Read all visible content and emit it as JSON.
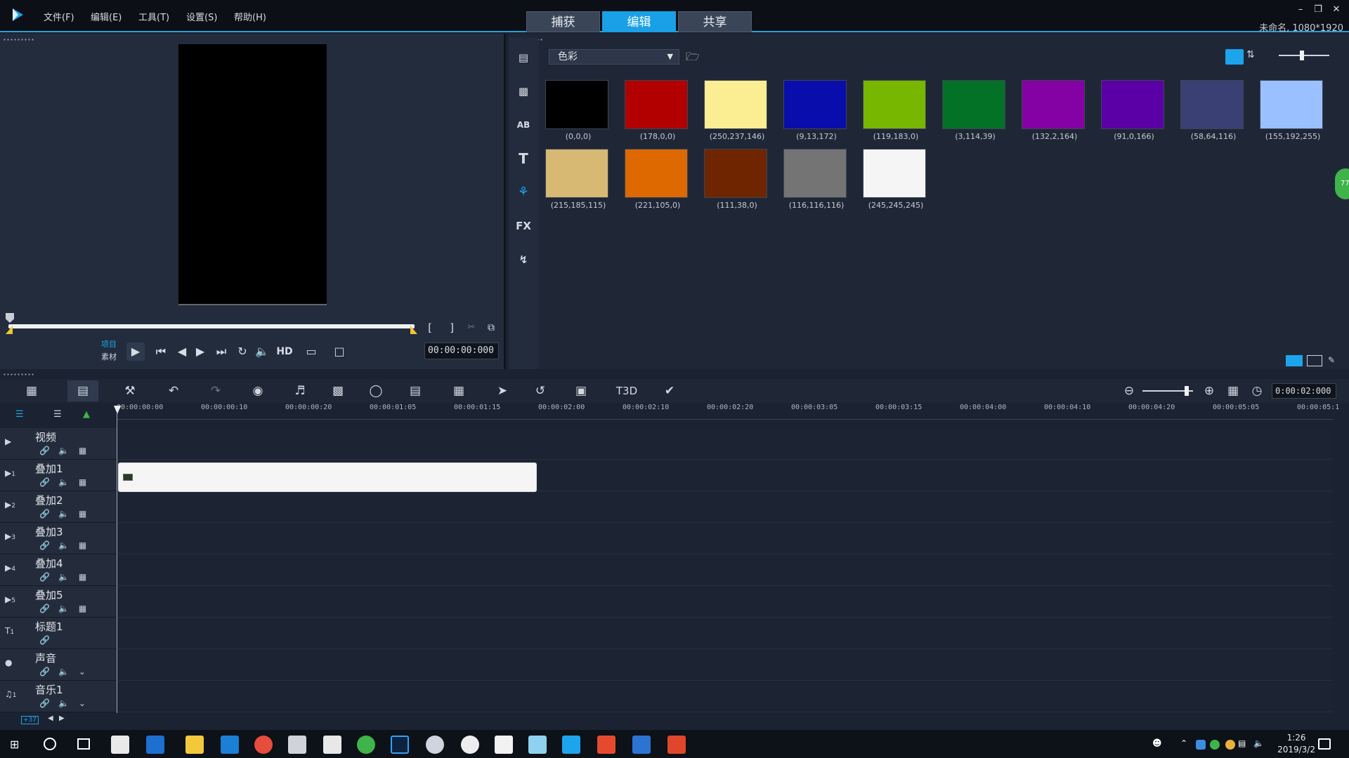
{
  "titlebar": {
    "menus": [
      "文件(F)",
      "编辑(E)",
      "工具(T)",
      "设置(S)",
      "帮助(H)"
    ],
    "mode_tabs": [
      {
        "label": "捕获",
        "active": false
      },
      {
        "label": "编辑",
        "active": true
      },
      {
        "label": "共享",
        "active": false
      }
    ],
    "project_info": "未命名, 1080*1920",
    "window_controls": [
      "minimize-icon",
      "restore-icon",
      "close-icon"
    ]
  },
  "player": {
    "mode_project": "项目",
    "mode_clip": "素材",
    "timecode": "00:00:00:000",
    "hd_label": "HD"
  },
  "library": {
    "dropdown": "色彩",
    "swatches": [
      {
        "label": "(0,0,0)",
        "color": "#000000"
      },
      {
        "label": "(178,0,0)",
        "color": "#b20000"
      },
      {
        "label": "(250,237,146)",
        "color": "#faed92"
      },
      {
        "label": "(9,13,172)",
        "color": "#090dac"
      },
      {
        "label": "(119,183,0)",
        "color": "#77b700"
      },
      {
        "label": "(3,114,39)",
        "color": "#037227"
      },
      {
        "label": "(132,2,164)",
        "color": "#8402a4"
      },
      {
        "label": "(91,0,166)",
        "color": "#5b00a6"
      },
      {
        "label": "(58,64,116)",
        "color": "#3a4074"
      },
      {
        "label": "(155,192,255)",
        "color": "#9bc0ff"
      },
      {
        "label": "(215,185,115)",
        "color": "#d7b973"
      },
      {
        "label": "(221,105,0)",
        "color": "#dd6900"
      },
      {
        "label": "(111,38,0)",
        "color": "#6f2600"
      },
      {
        "label": "(116,116,116)",
        "color": "#747474"
      },
      {
        "label": "(245,245,245)",
        "color": "#f5f5f5"
      }
    ],
    "side_icons": [
      "media-icon",
      "instant-project-icon",
      "transition-icon",
      "title-icon",
      "color-icon",
      "fx-icon",
      "path-icon"
    ],
    "fx_label": "FX",
    "title_glyph": "T",
    "transition_glyph": "AB"
  },
  "timeline": {
    "timecode": "0:00:02:000",
    "ruler": [
      "00:00:00:00",
      "00:00:00:10",
      "00:00:00:20",
      "00:00:01:05",
      "00:00:01:15",
      "00:00:02:00",
      "00:00:02:10",
      "00:00:02:20",
      "00:00:03:05",
      "00:00:03:15",
      "00:00:04:00",
      "00:00:04:10",
      "00:00:04:20",
      "00:00:05:05",
      "00:00:05:1"
    ],
    "tracks": [
      {
        "name": "视频",
        "icon": "video-track-icon",
        "badge": ""
      },
      {
        "name": "叠加1",
        "icon": "overlay-track-icon",
        "badge": "1"
      },
      {
        "name": "叠加2",
        "icon": "overlay-track-icon",
        "badge": "2"
      },
      {
        "name": "叠加3",
        "icon": "overlay-track-icon",
        "badge": "3"
      },
      {
        "name": "叠加4",
        "icon": "overlay-track-icon",
        "badge": "4"
      },
      {
        "name": "叠加5",
        "icon": "overlay-track-icon",
        "badge": "5"
      },
      {
        "name": "标题1",
        "icon": "title-track-icon",
        "badge": "1"
      },
      {
        "name": "声音",
        "icon": "voice-track-icon",
        "badge": ""
      },
      {
        "name": "音乐1",
        "icon": "music-track-icon",
        "badge": "1"
      }
    ],
    "bottom_badge": "+37"
  },
  "taskbar": {
    "time": "1:26",
    "date": "2019/3/2"
  }
}
